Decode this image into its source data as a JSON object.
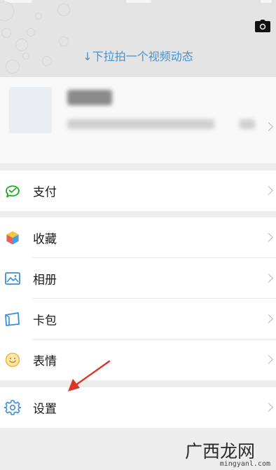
{
  "pull_hint": "↓下拉拍一个视频动态",
  "menu": {
    "pay": {
      "label": "支付",
      "icon": "wechat-pay-icon",
      "color": "#1aad19"
    },
    "favorites": {
      "label": "收藏",
      "icon": "favorites-cube-icon"
    },
    "album": {
      "label": "相册",
      "icon": "photo-album-icon",
      "color": "#3d8ed8"
    },
    "cards": {
      "label": "卡包",
      "icon": "card-wallet-icon",
      "color": "#3d8ed8"
    },
    "stickers": {
      "label": "表情",
      "icon": "smiley-icon",
      "color": "#f2b73a"
    },
    "settings": {
      "label": "设置",
      "icon": "gear-icon",
      "color": "#3d8ed8"
    }
  },
  "annotation": {
    "arrow_color": "#d9372a"
  },
  "watermark": {
    "text": "广西龙网",
    "sub": "mingyanl.com"
  }
}
